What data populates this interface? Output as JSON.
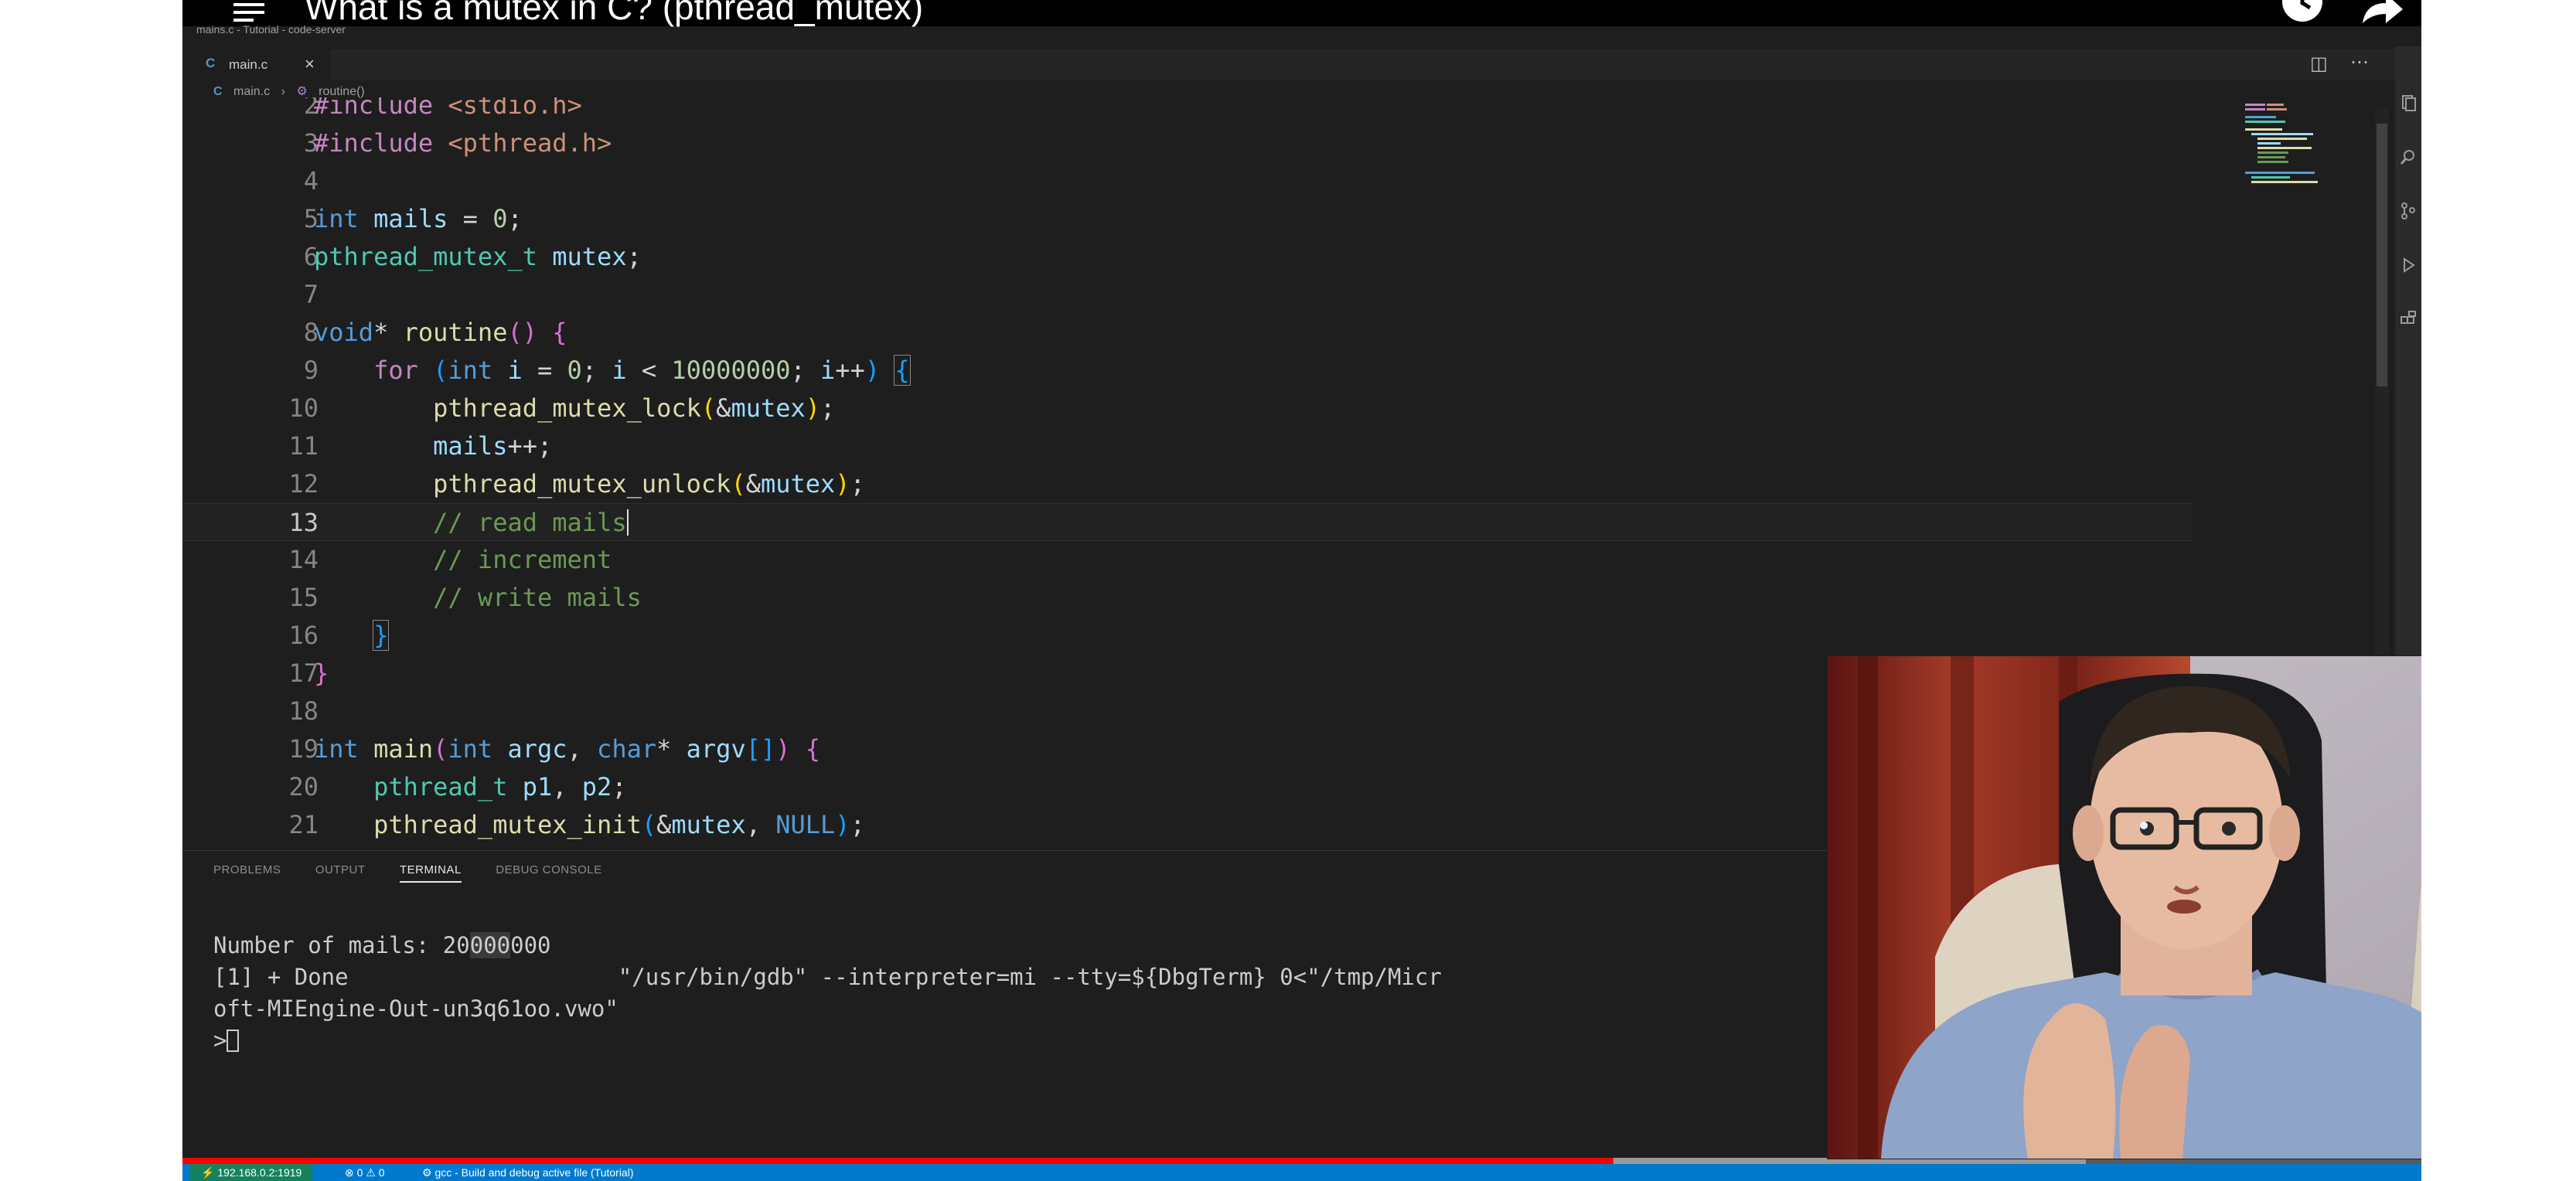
{
  "youtube": {
    "title": "What is a mutex in C? (pthread_mutex)",
    "overlay_small": "mains.c - Tutorial - code-server",
    "progress_played": 0.639,
    "progress_buffered": 0.85
  },
  "editor": {
    "tab_icon": "C",
    "tab_name": "main.c",
    "tab_close": "×",
    "breadcrumb": {
      "icon": "C",
      "file": "main.c",
      "separator": "›",
      "symbol_icon": "⚙",
      "symbol": "routine()"
    },
    "line_numbers": [
      "2",
      "3",
      "4",
      "5",
      "6",
      "7",
      "8",
      "9",
      "10",
      "11",
      "12",
      "13",
      "14",
      "15",
      "16",
      "17",
      "18",
      "19",
      "20",
      "21"
    ],
    "comments": {
      "l13": "// read mails",
      "l14": "// increment",
      "l15": "// write mails"
    }
  },
  "panel": {
    "tabs": [
      "PROBLEMS",
      "OUTPUT",
      "TERMINAL",
      "DEBUG CONSOLE"
    ],
    "active_tab": "TERMINAL",
    "terminal": {
      "line1_prefix": "Number of mails: 20",
      "line1_highlight": "000",
      "line1_suffix": "000",
      "line2": "[1] + Done                    \"/usr/bin/gdb\" --interpreter=mi --tty=${DbgTerm} 0<\"/tmp/Micr",
      "line3": "oft-MIEngine-Out-un3q61oo.vwo\"",
      "prompt": ">"
    }
  },
  "statusbar": {
    "remote": "⚡ 192.168.0.2:1919",
    "errors": "⊗ 0 ⚠ 0",
    "task": "⚙ gcc - Build and debug active file (Tutorial)"
  },
  "colors": {
    "editor_bg": "#1e1e1e",
    "status_blue": "#007acc",
    "progress_red": "#ff0000"
  }
}
